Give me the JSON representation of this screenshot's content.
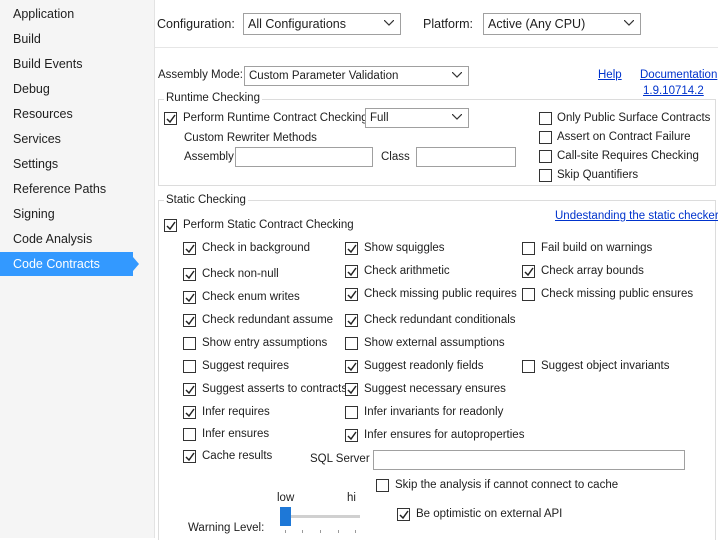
{
  "sidebar": {
    "items": [
      {
        "label": "Application"
      },
      {
        "label": "Build"
      },
      {
        "label": "Build Events"
      },
      {
        "label": "Debug"
      },
      {
        "label": "Resources"
      },
      {
        "label": "Services"
      },
      {
        "label": "Settings"
      },
      {
        "label": "Reference Paths"
      },
      {
        "label": "Signing"
      },
      {
        "label": "Code Analysis"
      },
      {
        "label": "Code Contracts"
      }
    ],
    "active_index": 10
  },
  "top": {
    "configuration_label": "Configuration:",
    "configuration_value": "All Configurations",
    "platform_label": "Platform:",
    "platform_value": "Active (Any CPU)"
  },
  "assembly": {
    "mode_label": "Assembly Mode:",
    "mode_value": "Custom Parameter Validation",
    "help_link": "Help",
    "documentation_link": "Documentation",
    "version_link": "1.9.10714.2"
  },
  "runtime": {
    "group_title": "Runtime Checking",
    "perform_label": "Perform Runtime Contract Checking",
    "perform_checked": true,
    "level_value": "Full",
    "rewriter_label": "Custom Rewriter Methods",
    "assembly_label": "Assembly",
    "assembly_value": "",
    "class_label": "Class",
    "class_value": "",
    "options": [
      {
        "label": "Only Public Surface Contracts",
        "checked": false
      },
      {
        "label": "Assert on Contract Failure",
        "checked": false
      },
      {
        "label": "Call-site Requires Checking",
        "checked": false
      },
      {
        "label": "Skip Quantifiers",
        "checked": false
      }
    ]
  },
  "static": {
    "group_title": "Static Checking",
    "perform_label": "Perform Static Contract Checking",
    "perform_checked": true,
    "understanding_link": "Undestanding the static checker",
    "col1": [
      {
        "label": "Check in background",
        "checked": true
      },
      {
        "label": "Check non-null",
        "checked": true
      },
      {
        "label": "Check enum writes",
        "checked": true
      },
      {
        "label": "Check redundant assume",
        "checked": true
      },
      {
        "label": "Show entry assumptions",
        "checked": false
      },
      {
        "label": "Suggest requires",
        "checked": false
      },
      {
        "label": "Suggest asserts to contracts",
        "checked": true
      },
      {
        "label": "Infer requires",
        "checked": true
      },
      {
        "label": "Infer ensures",
        "checked": false
      },
      {
        "label": "Cache results",
        "checked": true
      }
    ],
    "col2": [
      {
        "label": "Show squiggles",
        "checked": true
      },
      {
        "label": "Check arithmetic",
        "checked": true
      },
      {
        "label": "Check missing public requires",
        "checked": true
      },
      {
        "label": "Check redundant conditionals",
        "checked": true
      },
      {
        "label": "Show external assumptions",
        "checked": false
      },
      {
        "label": "Suggest readonly fields",
        "checked": true
      },
      {
        "label": "Suggest necessary ensures",
        "checked": true
      },
      {
        "label": "Infer invariants for readonly",
        "checked": false
      },
      {
        "label": "Infer ensures for autoproperties",
        "checked": true
      }
    ],
    "col3": [
      {
        "label": "Fail build on warnings",
        "checked": false
      },
      {
        "label": "Check array bounds",
        "checked": true
      },
      {
        "label": "Check missing public ensures",
        "checked": false
      },
      {
        "label": "Suggest object invariants",
        "checked": false
      }
    ],
    "sql_server_label": "SQL Server",
    "sql_server_value": "",
    "skip_analysis_label": "Skip the analysis if cannot connect to cache",
    "skip_analysis_checked": false,
    "optimistic_label": "Be optimistic on external API",
    "optimistic_checked": true,
    "warning_level_label": "Warning Level:",
    "slider_low_label": "low",
    "slider_high_label": "hi",
    "warning_level_fraction": 0.0
  }
}
